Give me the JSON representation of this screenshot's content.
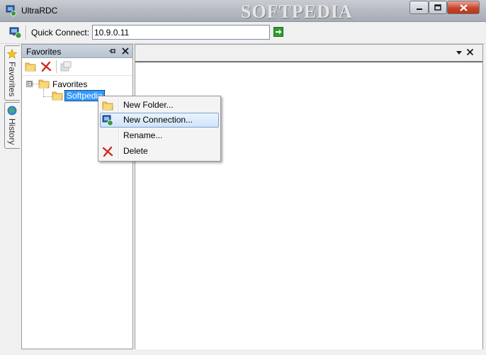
{
  "window": {
    "title": "UltraRDC",
    "title_watermark": "SOFTPEDIA",
    "controls": {
      "minimize_icon": "minimize-icon",
      "maximize_icon": "maximize-icon",
      "close_icon": "close-icon"
    }
  },
  "toolbar": {
    "quick_connect_label": "Quick Connect:",
    "quick_connect_value": "10.9.0.11",
    "go_icon": "arrow-right-icon"
  },
  "side_tabs": [
    {
      "label": "Favorites",
      "icon": "star-icon"
    },
    {
      "label": "History",
      "icon": "globe-icon"
    }
  ],
  "favorites_panel": {
    "title": "Favorites",
    "tools": [
      "new-folder-icon",
      "delete-icon",
      "properties-icon"
    ],
    "tree": {
      "root": {
        "label": "Favorites",
        "expander": "⊟"
      },
      "children": [
        {
          "label": "Softpedia",
          "selected": true
        }
      ]
    }
  },
  "context_menu": {
    "items": [
      {
        "label": "New Folder...",
        "icon": "folder-icon"
      },
      {
        "label": "New Connection...",
        "icon": "computer-icon",
        "highlighted": true
      },
      {
        "label": "Rename...",
        "icon": ""
      },
      {
        "label": "Delete",
        "icon": "delete-icon"
      }
    ]
  },
  "colors": {
    "selection": "#3399ff",
    "menu_highlight": "#cfe4fa",
    "close_button": "#c7462d",
    "go_button": "#2e9e2e"
  }
}
